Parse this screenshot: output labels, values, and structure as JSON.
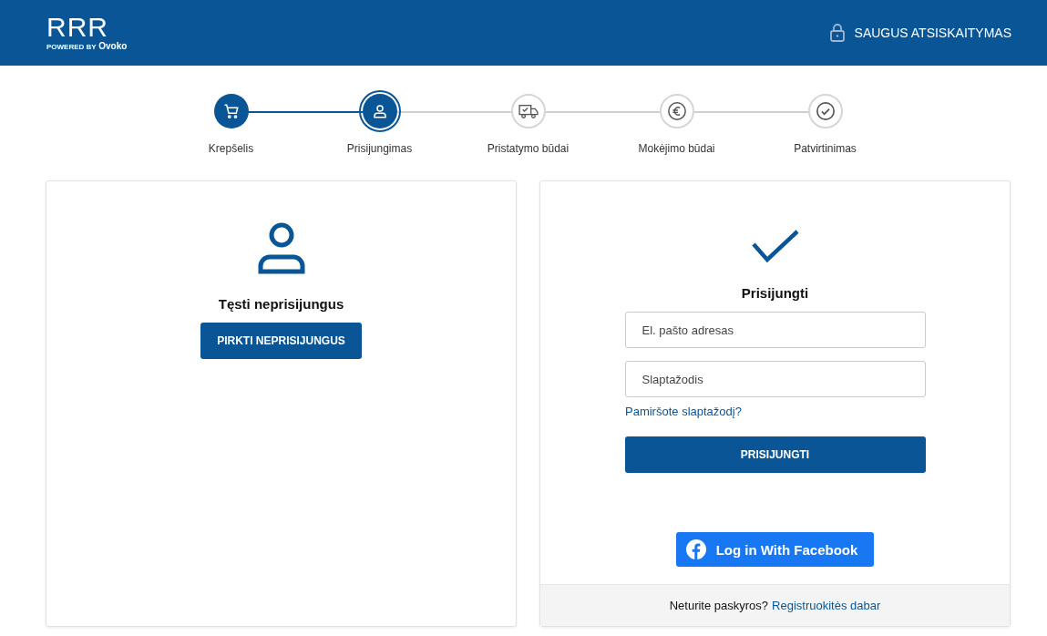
{
  "header": {
    "logo": "RRR",
    "powered_by": "POWERED BY",
    "brand": "Ovoko",
    "secure_label": "SAUGUS ATSISKAITYMAS"
  },
  "steps": [
    {
      "label": "Krepšelis",
      "kind": "cart",
      "completed": true,
      "selected": false
    },
    {
      "label": "Prisijungimas",
      "kind": "user",
      "completed": false,
      "selected": true
    },
    {
      "label": "Pristatymo būdai",
      "kind": "truck",
      "completed": false,
      "selected": false
    },
    {
      "label": "Mokėjimo būdai",
      "kind": "euro",
      "completed": false,
      "selected": false
    },
    {
      "label": "Patvirtinimas",
      "kind": "check",
      "completed": false,
      "selected": false
    }
  ],
  "guest": {
    "title": "Tęsti neprisijungus",
    "button": "PIRKTI NEPRISIJUNGUS"
  },
  "login": {
    "title": "Prisijungti",
    "email": {
      "placeholder": "El. pašto adresas"
    },
    "password": {
      "placeholder": "Slaptažodis"
    },
    "forgot_link": "Pamiršote slaptažodį?",
    "button": "PRISIJUNGTI",
    "facebook_button": "Log in With Facebook",
    "footer_text": "Neturite paskyros?",
    "register_link": "Registruokitės dabar"
  }
}
